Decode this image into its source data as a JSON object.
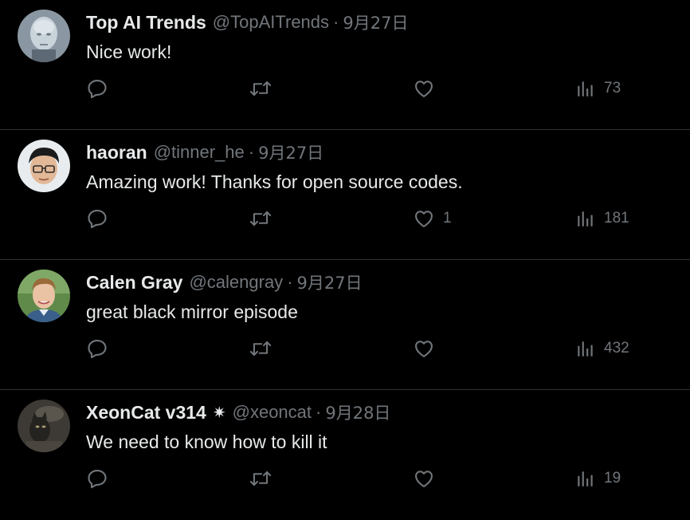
{
  "tweets": [
    {
      "name": "Top AI Trends",
      "handle": "@TopAITrends",
      "separator": "·",
      "date": "9月27日",
      "text": "Nice work!",
      "likes": "",
      "views": "73",
      "avatar": "bald-head-avatar",
      "verified": false
    },
    {
      "name": "haoran",
      "handle": "@tinner_he",
      "separator": "·",
      "date": "9月27日",
      "text": "Amazing work! Thanks for open source codes.",
      "likes": "1",
      "views": "181",
      "avatar": "glasses-person-avatar",
      "verified": false
    },
    {
      "name": "Calen Gray",
      "handle": "@calengray",
      "separator": "·",
      "date": "9月27日",
      "text": "great black mirror episode",
      "likes": "",
      "views": "432",
      "avatar": "smiling-person-avatar",
      "verified": false
    },
    {
      "name": "XeonCat v314",
      "handle": "@xeoncat",
      "separator": "·",
      "date": "9月28日",
      "text": "We need to know how to kill it",
      "likes": "",
      "views": "19",
      "avatar": "dark-cat-avatar",
      "verified": true,
      "badge": "✷"
    }
  ],
  "colors": {
    "background": "#000000",
    "primary_text": "#e7e9ea",
    "secondary_text": "#71767b",
    "divider": "#2f3336"
  },
  "icons": [
    "reply-icon",
    "retweet-icon",
    "like-icon",
    "views-icon"
  ]
}
